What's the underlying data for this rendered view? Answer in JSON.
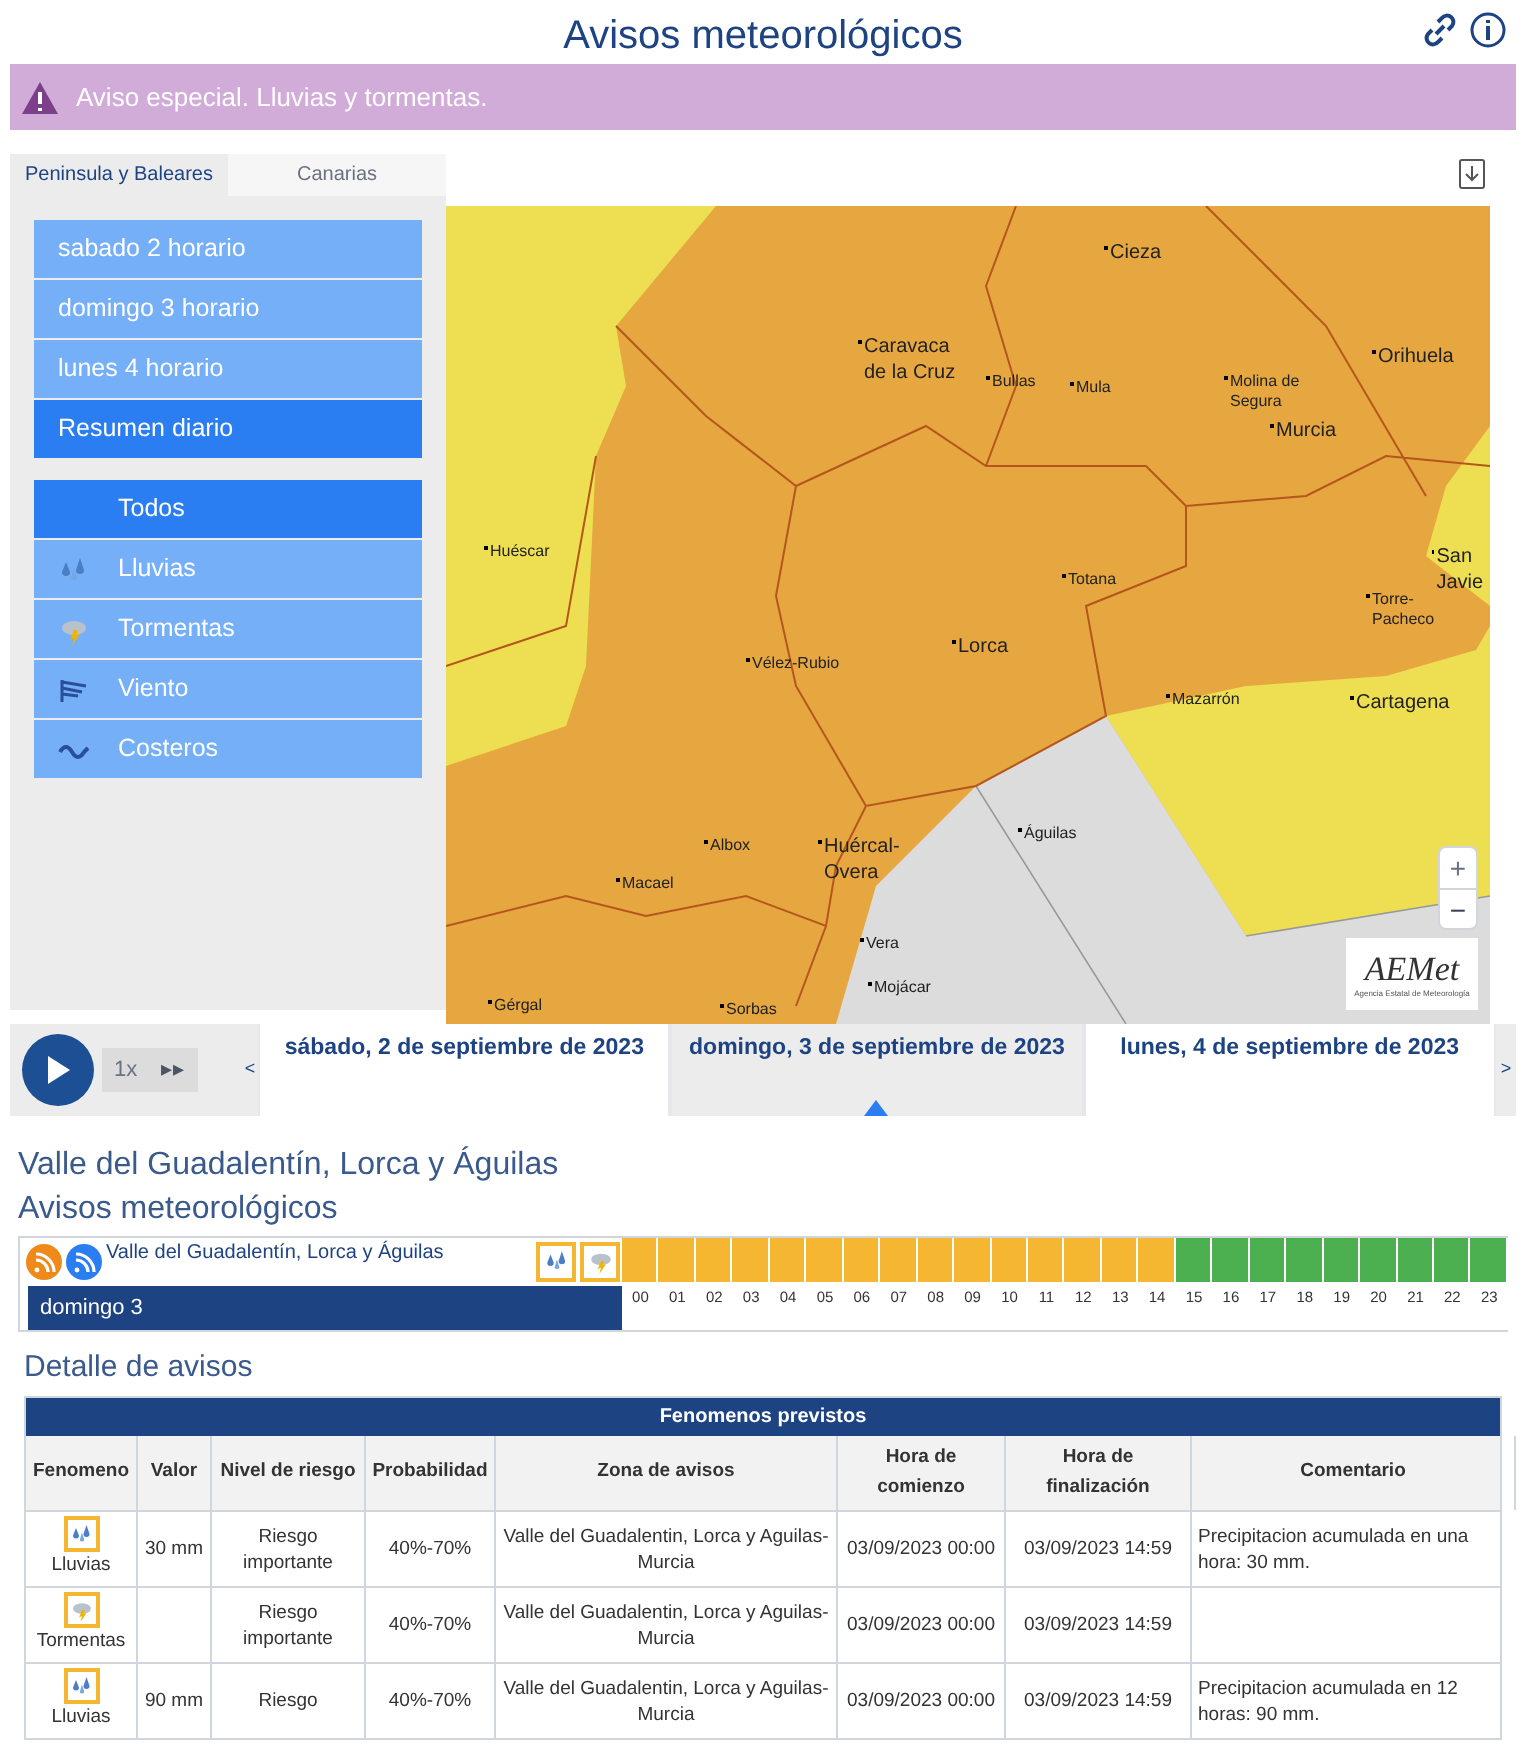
{
  "title": "Avisos meteorológicos",
  "alert": {
    "text": "Aviso especial. Lluvias y tormentas."
  },
  "region_tabs": [
    {
      "label": "Peninsula y Baleares",
      "selected": true
    },
    {
      "label": "Canarias",
      "selected": false
    }
  ],
  "day_items": [
    {
      "label": "sabado 2 horario",
      "selected": false
    },
    {
      "label": "domingo 3 horario",
      "selected": false
    },
    {
      "label": "lunes 4 horario",
      "selected": false
    },
    {
      "label": "Resumen diario",
      "selected": true
    }
  ],
  "filter_items": [
    {
      "label": "Todos",
      "kind": "all",
      "selected": true
    },
    {
      "label": "Lluvias",
      "kind": "rain",
      "selected": false
    },
    {
      "label": "Tormentas",
      "kind": "storm",
      "selected": false
    },
    {
      "label": "Viento",
      "kind": "wind",
      "selected": false
    },
    {
      "label": "Costeros",
      "kind": "coast",
      "selected": false
    }
  ],
  "map": {
    "places": [
      {
        "name": "Cieza",
        "kind": "town"
      },
      {
        "name": "Caravaca de la Cruz",
        "kind": "city"
      },
      {
        "name": "Bullas",
        "kind": "village"
      },
      {
        "name": "Mula",
        "kind": "village"
      },
      {
        "name": "Molina de Segura",
        "kind": "village"
      },
      {
        "name": "Murcia",
        "kind": "city"
      },
      {
        "name": "Orihuela",
        "kind": "town"
      },
      {
        "name": "Huéscar",
        "kind": "village"
      },
      {
        "name": "Totana",
        "kind": "village"
      },
      {
        "name": "Lorca",
        "kind": "city"
      },
      {
        "name": "Vélez-Rubio",
        "kind": "village"
      },
      {
        "name": "San Javie",
        "kind": "town"
      },
      {
        "name": "Torre-Pacheco",
        "kind": "village"
      },
      {
        "name": "Mazarrón",
        "kind": "village"
      },
      {
        "name": "Cartagena",
        "kind": "city"
      },
      {
        "name": "Águilas",
        "kind": "village"
      },
      {
        "name": "Albox",
        "kind": "village"
      },
      {
        "name": "Huércal-Overa",
        "kind": "city"
      },
      {
        "name": "Macael",
        "kind": "village"
      },
      {
        "name": "Vera",
        "kind": "village"
      },
      {
        "name": "Mojácar",
        "kind": "village"
      },
      {
        "name": "Gérgal",
        "kind": "village"
      },
      {
        "name": "Sorbas",
        "kind": "village"
      }
    ],
    "zoom_in": "+",
    "zoom_out": "−",
    "logo": {
      "name": "AEMet",
      "subtitle": "Agencia Estatal de Meteorología"
    }
  },
  "player": {
    "speed": "1x",
    "fast_forward": "▸▸"
  },
  "date_tabs": [
    {
      "label": "sábado, 2 de septiembre de 2023",
      "selected": false
    },
    {
      "label": "domingo, 3 de septiembre de 2023",
      "selected": true
    },
    {
      "label": "lunes, 4 de septiembre de 2023",
      "selected": false
    }
  ],
  "prev": "<",
  "next": ">",
  "zone_title": "Valle del Guadalentín, Lorca y Águilas",
  "section_title": "Avisos meteorológicos",
  "timeline": {
    "zone_link": "Valle del Guadalentín, Lorca y Águilas",
    "day": "domingo 3",
    "hours": [
      {
        "label": "00",
        "color": "#f5b731"
      },
      {
        "label": "01",
        "color": "#f5b731"
      },
      {
        "label": "02",
        "color": "#f5b731"
      },
      {
        "label": "03",
        "color": "#f5b731"
      },
      {
        "label": "04",
        "color": "#f5b731"
      },
      {
        "label": "05",
        "color": "#f5b731"
      },
      {
        "label": "06",
        "color": "#f5b731"
      },
      {
        "label": "07",
        "color": "#f5b731"
      },
      {
        "label": "08",
        "color": "#f5b731"
      },
      {
        "label": "09",
        "color": "#f5b731"
      },
      {
        "label": "10",
        "color": "#f5b731"
      },
      {
        "label": "11",
        "color": "#f5b731"
      },
      {
        "label": "12",
        "color": "#f5b731"
      },
      {
        "label": "13",
        "color": "#f5b731"
      },
      {
        "label": "14",
        "color": "#f5b731"
      },
      {
        "label": "15",
        "color": "#4caf50"
      },
      {
        "label": "16",
        "color": "#4caf50"
      },
      {
        "label": "17",
        "color": "#4caf50"
      },
      {
        "label": "18",
        "color": "#4caf50"
      },
      {
        "label": "19",
        "color": "#4caf50"
      },
      {
        "label": "20",
        "color": "#4caf50"
      },
      {
        "label": "21",
        "color": "#4caf50"
      },
      {
        "label": "22",
        "color": "#4caf50"
      },
      {
        "label": "23",
        "color": "#4caf50"
      }
    ]
  },
  "detail_title": "Detalle de avisos",
  "table": {
    "caption": "Fenomenos previstos",
    "columns": [
      "Fenomeno",
      "Valor",
      "Nivel de riesgo",
      "Probabilidad",
      "Zona de avisos",
      "Hora de comienzo",
      "Hora de finalización",
      "Comentario"
    ],
    "rows": [
      {
        "kind": "rain",
        "phenomenon": "Lluvias",
        "value": "30 mm",
        "risk": "Riesgo importante",
        "probability": "40%-70%",
        "zone": "Valle del Guadalentin, Lorca y Aguilas-Murcia",
        "start": "03/09/2023 00:00",
        "end": "03/09/2023 14:59",
        "comment": "Precipitacion acumulada en una hora: 30 mm."
      },
      {
        "kind": "storm",
        "phenomenon": "Tormentas",
        "risk": "Riesgo importante",
        "probability": "40%-70%",
        "zone": "Valle del Guadalentin, Lorca y Aguilas-Murcia",
        "start": "03/09/2023 00:00",
        "end": "03/09/2023 14:59"
      },
      {
        "kind": "rain",
        "phenomenon": "Lluvias",
        "value": "90 mm",
        "risk": "Riesgo",
        "probability": "40%-70%",
        "zone": "Valle del Guadalentin, Lorca y Aguilas-Murcia",
        "start": "03/09/2023 00:00",
        "end": "03/09/2023 14:59",
        "comment": "Precipitacion acumulada en 12 horas: 90 mm."
      }
    ]
  }
}
